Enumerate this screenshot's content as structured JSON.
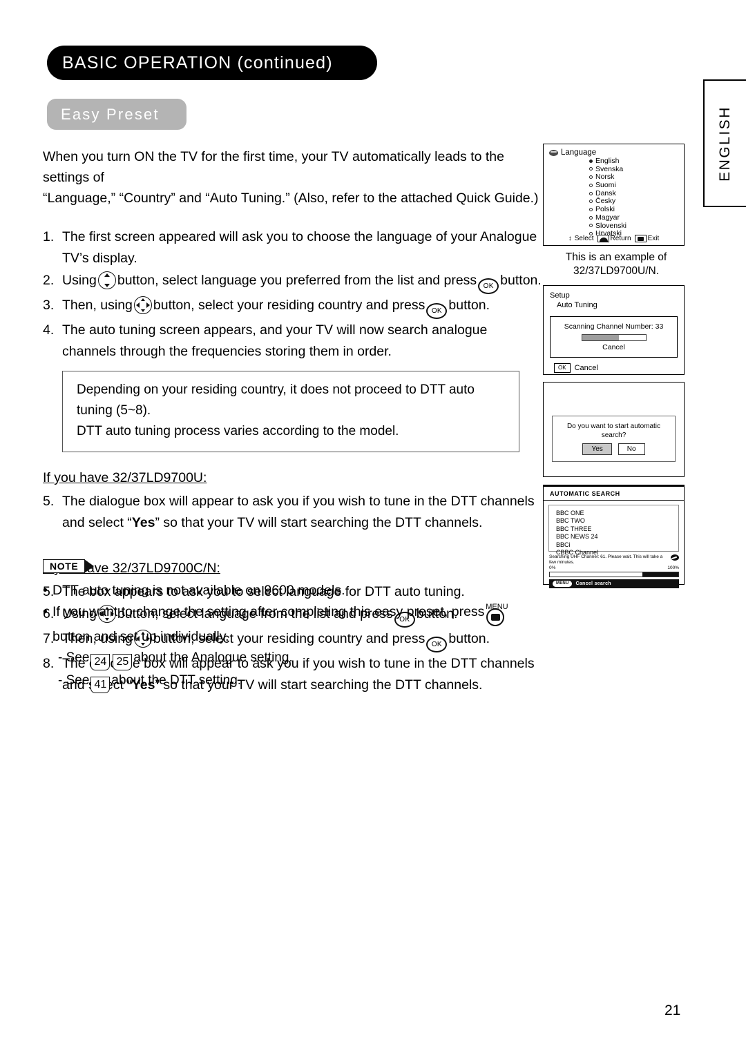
{
  "header": {
    "banner_title": "BASIC OPERATION (continued)",
    "section_title": "Easy Preset"
  },
  "side_tab": {
    "label": "ENGLISH"
  },
  "intro": {
    "line1": "When you turn ON the TV for the first time, your TV automatically leads to the settings of",
    "line2": "“Language,” “Country” and “Auto Tuning.” (Also, refer to the attached Quick Guide.)"
  },
  "steps": {
    "s1_num": "1.",
    "s1_text": "The first screen appeared will ask you to choose the language of your Analogue TV’s display.",
    "s2_num": "2.",
    "s2_a": "Using",
    "s2_b": "button, select language you preferred from the list and press",
    "s2_c": "button.",
    "s3_num": "3.",
    "s3_a": "Then, using",
    "s3_b": "button, select your residing country and press",
    "s3_c": "button.",
    "s4_num": "4.",
    "s4_text": "The auto tuning screen appears, and your TV will now search analogue channels through the frequencies storing them in order.",
    "s5u_num": "5.",
    "s5u_a": "The dialogue box will appear to ask you if you wish to tune in the DTT channels and select “",
    "s5u_bold": "Yes",
    "s5u_b": "” so that your TV will start searching the DTT channels.",
    "s5c_num": "5.",
    "s5c_text": "The box appears to ask you to select language for DTT auto tuning.",
    "s6_num": "6.",
    "s6_a": "Using",
    "s6_b": "button, select language from the list and press",
    "s6_c": "button.",
    "s7_num": "7.",
    "s7_a": "Then, using",
    "s7_b": "button, select your residing country and press",
    "s7_c": "button.",
    "s8_num": "8.",
    "s8_a": "The dialogue box will appear to ask you if you wish to tune in the DTT channels and select “",
    "s8_bold": "Yes",
    "s8_b": "” so that your TV will start searching the DTT channels."
  },
  "callout": {
    "line1": "Depending on your residing country, it does not proceed to DTT auto tuning (5~8).",
    "line2": "DTT auto tuning process varies according to the model."
  },
  "subheads": {
    "model_u": "If you have 32/37LD9700U:",
    "model_cn": "If you have 32/37LD9700C/N:"
  },
  "note": {
    "badge": "NOTE",
    "bullet1": "DTT auto tuning is not available on 9600 models.",
    "bullet2_a": "If you want to change the setting after completing this easy preset, press",
    "menu_label": "MENU",
    "bullet2_b": "button and set up individually.",
    "sub1_a": "- See",
    "sub1_ref1": "24",
    "sub1_ref2": "25",
    "sub1_b": "about the Analogue setting.",
    "sub2_a": "- See",
    "sub2_ref": "41",
    "sub2_b": "about the DTT setting."
  },
  "language_screen": {
    "title": "Language",
    "items": [
      {
        "label": "English",
        "selected": true
      },
      {
        "label": "Svenska",
        "selected": false
      },
      {
        "label": "Norsk",
        "selected": false
      },
      {
        "label": "Suomi",
        "selected": false
      },
      {
        "label": "Dansk",
        "selected": false
      },
      {
        "label": "Česky",
        "selected": false
      },
      {
        "label": "Polski",
        "selected": false
      },
      {
        "label": "Magyar",
        "selected": false
      },
      {
        "label": "Slovenski",
        "selected": false
      },
      {
        "label": "Hrvatski",
        "selected": false
      }
    ],
    "footer_select": "Select",
    "footer_return": "Return",
    "footer_exit": "Exit",
    "caption_line1": "This is an example of",
    "caption_line2": "32/37LD9700U/N."
  },
  "setup_screen": {
    "title": "Setup",
    "subtitle": "Auto Tuning",
    "scan_label": "Scanning Channel Number: 33",
    "progress_percent": 58,
    "scan_cancel": "Cancel",
    "ok_key": "OK",
    "ok_label": "Cancel"
  },
  "dialog_screen": {
    "question": "Do you want to start automatic search?",
    "yes_label": "Yes",
    "no_label": "No"
  },
  "autosearch_screen": {
    "title": "AUTOMATIC SEARCH",
    "channels": [
      "BBC ONE",
      "BBC TWO",
      "BBC THREE",
      "BBC NEWS 24",
      "BBCi",
      "CBBC Channel"
    ],
    "status": "Searching UHF Channel: 61. Please wait. This will take a few minutes.",
    "pct_min": "0%",
    "pct_max": "100%",
    "progress_percent": 28,
    "menu_pill": "MENU",
    "footer_label": "Cancel  search"
  },
  "page_number": "21"
}
